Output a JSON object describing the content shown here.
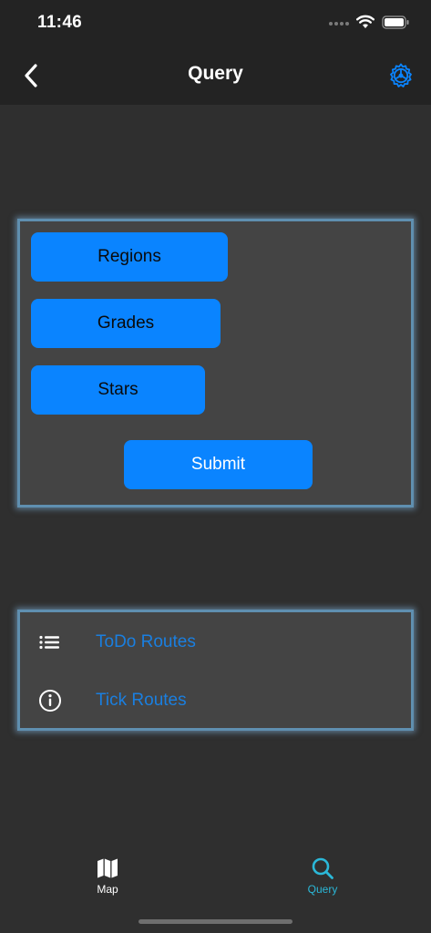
{
  "status_bar": {
    "time": "11:46"
  },
  "nav": {
    "title": "Query",
    "back_icon": "chevron-left-icon",
    "settings_icon": "gear-icon"
  },
  "query_form": {
    "regions_label": "Regions",
    "grades_label": "Grades",
    "stars_label": "Stars",
    "submit_label": "Submit"
  },
  "routes": {
    "items": [
      {
        "label": "ToDo Routes",
        "icon": "list-icon"
      },
      {
        "label": "Tick Routes",
        "icon": "info-icon"
      }
    ]
  },
  "tab_bar": {
    "tabs": [
      {
        "label": "Map",
        "icon": "map-icon",
        "selected": false
      },
      {
        "label": "Query",
        "icon": "search-icon",
        "selected": true
      }
    ]
  },
  "colors": {
    "accent": "#0a84ff",
    "link": "#1a7fe0",
    "tab_selected": "#2bb8d8",
    "background": "#2f2f2f",
    "card": "#444444",
    "card_border": "#5f8fb0"
  }
}
